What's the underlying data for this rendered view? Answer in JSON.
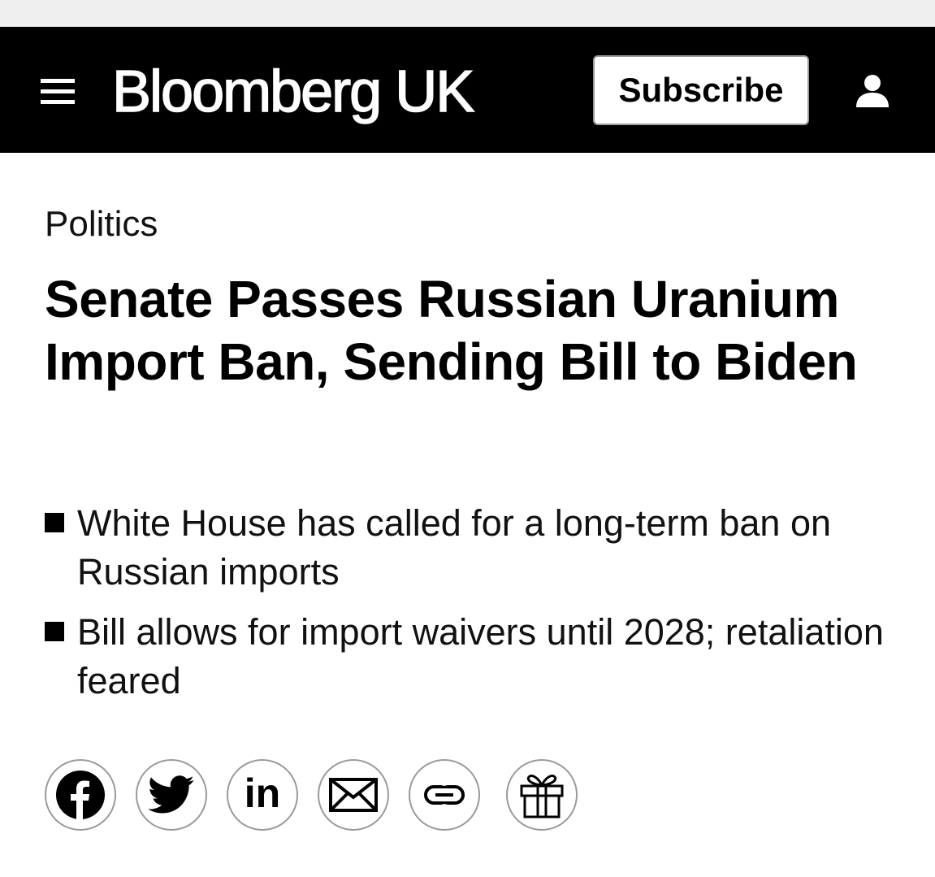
{
  "masthead": {
    "brand": "Bloomberg UK",
    "subscribe_label": "Subscribe",
    "background": "#000000"
  },
  "article": {
    "kicker": "Politics",
    "headline": "Senate Passes Russian Uranium Import Ban, Sending Bill to Biden",
    "bullets": [
      "White House has called for a long-term ban on Russian imports",
      "Bill allows for import waivers until 2028; retaliation feared"
    ]
  },
  "share": {
    "linkedin_label": "in",
    "icons": [
      "facebook-icon",
      "twitter-icon",
      "linkedin-icon",
      "email-icon",
      "link-icon",
      "gift-icon"
    ]
  }
}
